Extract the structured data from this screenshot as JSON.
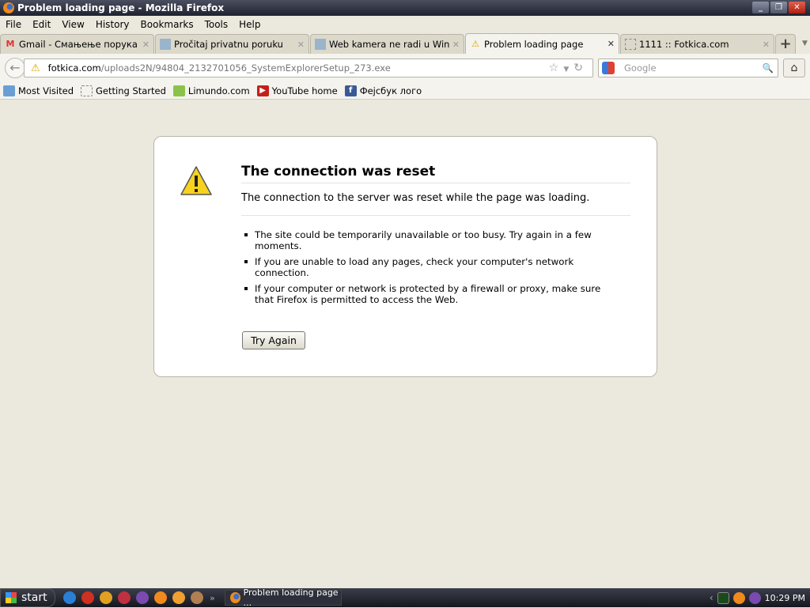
{
  "window": {
    "title": "Problem loading page - Mozilla Firefox"
  },
  "menu": [
    "File",
    "Edit",
    "View",
    "History",
    "Bookmarks",
    "Tools",
    "Help"
  ],
  "tabs": [
    {
      "label": "Gmail - Смањење порука - а...",
      "icon": "gmail-icon",
      "active": false
    },
    {
      "label": "Pročitaj privatnu poruku",
      "icon": "site-icon",
      "active": false
    },
    {
      "label": "Web kamera ne radi u Windo...",
      "icon": "site-icon",
      "active": false
    },
    {
      "label": "Problem loading page",
      "icon": "warning-icon",
      "active": true
    },
    {
      "label": "1111 :: Fotkica.com",
      "icon": "blank-page-icon",
      "active": false
    }
  ],
  "url": {
    "domain": "fotkica.com",
    "path": "/uploads2N/94804_2132701056_SystemExplorerSetup_273.exe"
  },
  "search": {
    "placeholder": "Google"
  },
  "bookmarks": [
    "Most Visited",
    "Getting Started",
    "Limundo.com",
    "YouTube home",
    "Фејсбук лого"
  ],
  "error": {
    "title": "The connection was reset",
    "description": "The connection to the server was reset while the page was loading.",
    "items": [
      "The site could be temporarily unavailable or too busy. Try again in a few moments.",
      "If you are unable to load any pages, check your computer's network connection.",
      "If your computer or network is protected by a firewall or proxy, make sure that Firefox is permitted to access the Web."
    ],
    "button": "Try Again"
  },
  "taskbar": {
    "start": "start",
    "task": "Problem loading page ...",
    "clock": "10:29 PM"
  }
}
